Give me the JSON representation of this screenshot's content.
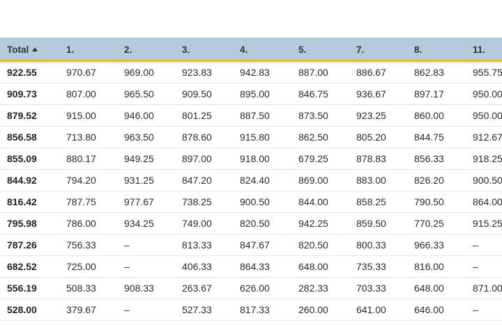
{
  "table": {
    "sort_icon": "sort-ascending-icon",
    "colors": {
      "header_background": "#b3cbdd",
      "header_underline": "#f0b72d",
      "row_divider": "#e2e4e6"
    },
    "headers": [
      "Total",
      "1.",
      "2.",
      "3.",
      "4.",
      "5.",
      "7.",
      "8.",
      "11."
    ],
    "rows": [
      [
        "922.55",
        "970.67",
        "969.00",
        "923.83",
        "942.83",
        "887.00",
        "886.67",
        "862.83",
        "955.75"
      ],
      [
        "909.73",
        "807.00",
        "965.50",
        "909.50",
        "895.00",
        "846.75",
        "936.67",
        "897.17",
        "950.00"
      ],
      [
        "879.52",
        "915.00",
        "946.00",
        "801.25",
        "887.50",
        "873.50",
        "923.25",
        "860.00",
        "950.00"
      ],
      [
        "856.58",
        "713.80",
        "963.50",
        "878.60",
        "915.80",
        "862.50",
        "805.20",
        "844.75",
        "912.67"
      ],
      [
        "855.09",
        "880.17",
        "949.25",
        "897.00",
        "918.00",
        "679.25",
        "878.83",
        "856.33",
        "918.25"
      ],
      [
        "844.92",
        "794.20",
        "931.25",
        "847.20",
        "824.40",
        "869.00",
        "883.00",
        "826.20",
        "900.50"
      ],
      [
        "816.42",
        "787.75",
        "977.67",
        "738.25",
        "900.50",
        "844.00",
        "858.25",
        "790.50",
        "864.00"
      ],
      [
        "795.98",
        "786.00",
        "934.25",
        "749.00",
        "820.50",
        "942.25",
        "859.50",
        "770.25",
        "915.25"
      ],
      [
        "787.26",
        "756.33",
        "–",
        "813.33",
        "847.67",
        "820.50",
        "800.33",
        "966.33",
        "–"
      ],
      [
        "682.52",
        "725.00",
        "–",
        "406.33",
        "864.33",
        "648.00",
        "735.33",
        "816.00",
        "–"
      ],
      [
        "556.19",
        "508.33",
        "908.33",
        "263.67",
        "626.00",
        "282.33",
        "703.33",
        "648.00",
        "871.00"
      ],
      [
        "528.00",
        "379.67",
        "–",
        "527.33",
        "817.33",
        "260.00",
        "641.00",
        "646.00",
        "–"
      ]
    ]
  }
}
